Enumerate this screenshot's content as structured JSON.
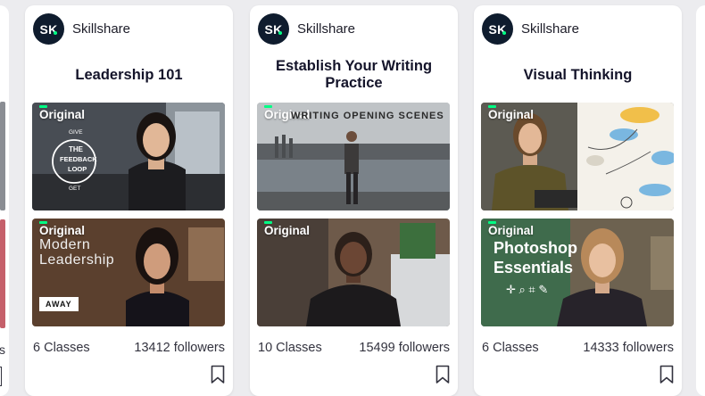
{
  "cards": [
    {
      "brand": "Skillshare",
      "logo_text": "SK",
      "title": "Leadership 101",
      "thumb1": {
        "badge": "Original",
        "overlay": [
          "GIVE",
          "THE",
          "FEEDBACK",
          "LOOP",
          "GET"
        ]
      },
      "thumb2": {
        "badge": "Original",
        "overlay": [
          "Modern",
          "Leadership"
        ],
        "tag": "AWAY"
      },
      "classes": "6 Classes",
      "followers": "13412 followers"
    },
    {
      "brand": "Skillshare",
      "logo_text": "SK",
      "title": "Establish Your Writing Practice",
      "thumb1": {
        "badge": "Original",
        "overlay": [
          "WRITING OPENING SCENES"
        ]
      },
      "thumb2": {
        "badge": "Original"
      },
      "classes": "10 Classes",
      "followers": "15499 followers"
    },
    {
      "brand": "Skillshare",
      "logo_text": "SK",
      "title": "Visual Thinking",
      "thumb1": {
        "badge": "Original"
      },
      "thumb2": {
        "badge": "Original",
        "overlay": [
          "Photoshop",
          "Essentials"
        ]
      },
      "classes": "6 Classes",
      "followers": "14333 followers"
    }
  ],
  "partial_left": {
    "footer_fragment": "s"
  },
  "colors": {
    "brand_green": "#00ff84",
    "logo_navy": "#0f1c2e",
    "page_bg": "#ececef"
  }
}
